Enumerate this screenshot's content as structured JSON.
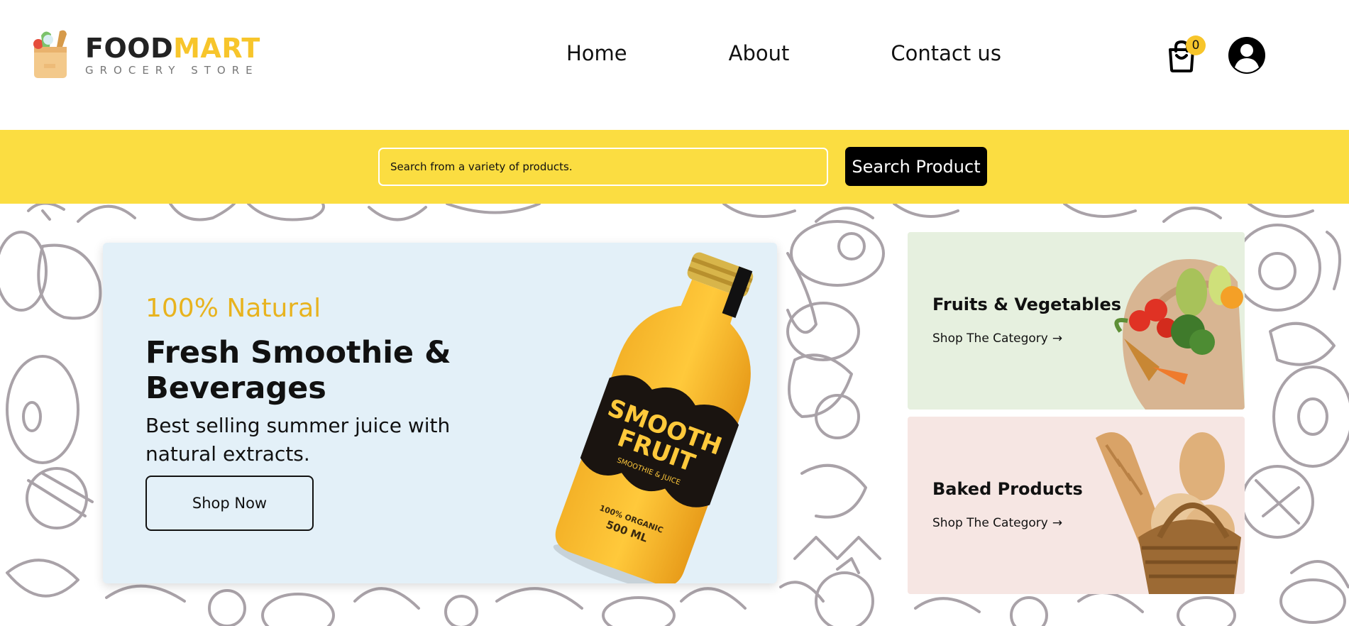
{
  "brand": {
    "name_part1": "FOOD",
    "name_part2": "MART",
    "tagline": "GROCERY STORE"
  },
  "nav": {
    "items": [
      {
        "label": "Home"
      },
      {
        "label": "About"
      },
      {
        "label": "Contact us"
      }
    ]
  },
  "cart": {
    "count": "0",
    "icon": "shopping-bag-icon"
  },
  "user": {
    "icon": "user-avatar-icon"
  },
  "search": {
    "placeholder": "Search from a variety of products.",
    "button_label": "Search Product"
  },
  "hero": {
    "kicker": "100% Natural",
    "title": "Fresh Smoothie & Beverages",
    "description": "Best selling summer juice with natural extracts.",
    "cta_label": "Shop Now",
    "bottle_label_line1": "SMOOTH",
    "bottle_label_line2": "FRUIT",
    "bottle_sub": "SMOOTHIE & JUICE",
    "bottle_organic": "100% ORGANIC",
    "bottle_volume": "500 ML"
  },
  "categories": [
    {
      "title": "Fruits & Vegetables",
      "link_label": "Shop The Category",
      "arrow": "→"
    },
    {
      "title": "Baked Products",
      "link_label": "Shop The Category",
      "arrow": "→"
    }
  ],
  "colors": {
    "accent": "#fbdd41",
    "brand_yellow": "#f7c52b",
    "hero_bg": "#e3f0f8",
    "fruit_bg": "#e6f0df",
    "baked_bg": "#f6e6e3",
    "pattern_stroke": "#a9a2a8"
  }
}
